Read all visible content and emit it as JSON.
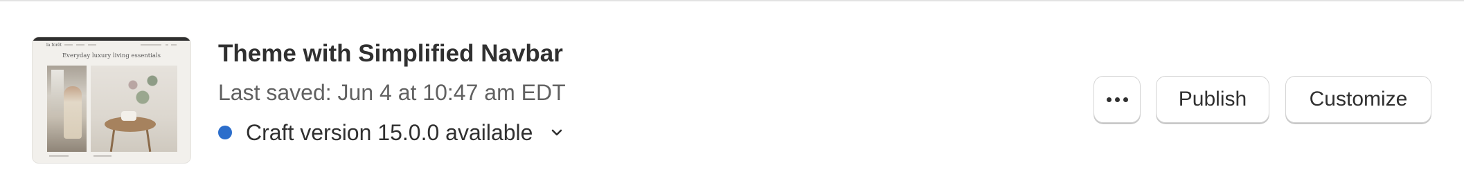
{
  "theme": {
    "name": "Theme with Simplified Navbar",
    "last_saved": "Last saved: Jun 4 at 10:47 am EDT",
    "update_notice": "Craft version 15.0.0 available",
    "status_color": "#2c6ecb",
    "thumbnail": {
      "logo": "la forêt",
      "heading": "Everyday luxury living essentials"
    }
  },
  "actions": {
    "more_icon": "ellipsis-horizontal-icon",
    "publish_label": "Publish",
    "customize_label": "Customize"
  },
  "icons": {
    "expand": "chevron-down-icon"
  }
}
